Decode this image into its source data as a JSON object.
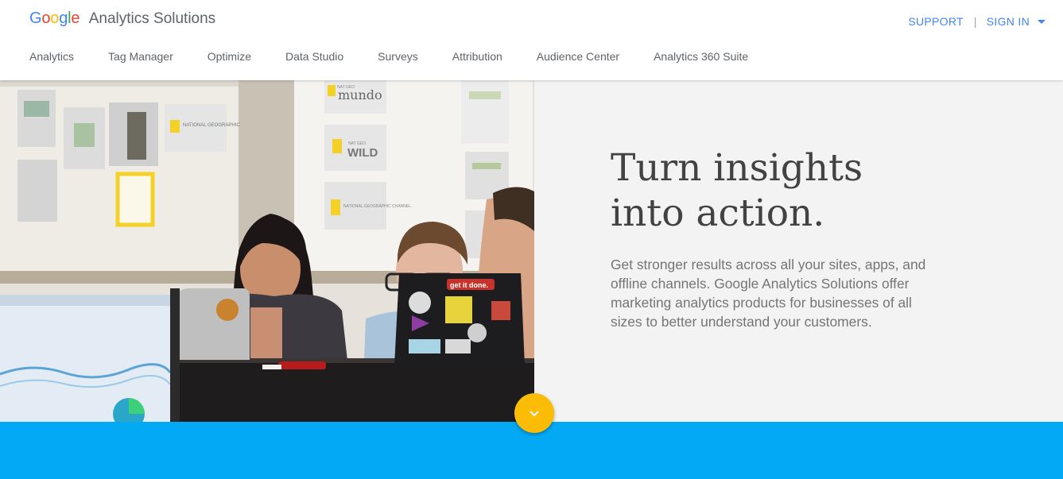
{
  "brand": {
    "logo_letters": [
      "G",
      "o",
      "o",
      "g",
      "l",
      "e"
    ],
    "logo_colors": [
      "#4285F4",
      "#EA4335",
      "#FBBC05",
      "#4285F4",
      "#34A853",
      "#EA4335"
    ],
    "product": "Analytics Solutions"
  },
  "topbar": {
    "support": "SUPPORT",
    "separator": "|",
    "signin": "SIGN IN"
  },
  "nav": {
    "items": [
      "Analytics",
      "Tag Manager",
      "Optimize",
      "Data Studio",
      "Surveys",
      "Attribution",
      "Audience Center",
      "Analytics 360 Suite"
    ]
  },
  "hero": {
    "title_line1": "Turn insights",
    "title_line2": "into action.",
    "body": "Get stronger results across all your sites, apps, and offline channels. Google Analytics Solutions offer marketing analytics products for businesses of all sizes to better understand your customers.",
    "photo_signs": {
      "mundo_small": "NAT GEO",
      "mundo": "mundo",
      "wild_small": "NAT GEO",
      "wild": "WILD",
      "natgeo": "NATIONAL GEOGRAPHIC",
      "natgeo_channel": "NATIONAL GEOGRAPHIC CHANNEL",
      "sticker": "get it done."
    }
  },
  "scroll_button": {
    "icon": "chevron-down-icon"
  },
  "colors": {
    "accent_blue": "#4285F4",
    "band_blue": "#03A9F4",
    "scroll_yellow": "#FBBC05",
    "hero_bg": "#F3F3F3"
  }
}
